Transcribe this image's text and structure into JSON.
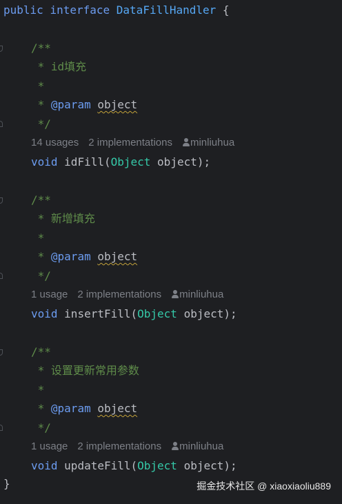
{
  "code": {
    "decl": {
      "kw1": "public",
      "kw2": "interface",
      "name": "DataFillHandler",
      "brace": "{"
    },
    "close_brace": "}",
    "methods": [
      {
        "comment_open": "/**",
        "desc": " * id填充",
        "blank": " *",
        "param_star": " * ",
        "param_tag": "@param",
        "param_name": "object",
        "comment_close": " */",
        "hint_usages": "14 usages",
        "hint_impl": "2 implementations",
        "hint_author": "minliuhua",
        "ret": "void",
        "name": "idFill",
        "ptype": "Object",
        "pname": "object",
        "end": ");"
      },
      {
        "comment_open": "/**",
        "desc": " * 新增填充",
        "blank": " *",
        "param_star": " * ",
        "param_tag": "@param",
        "param_name": "object",
        "comment_close": " */",
        "hint_usages": "1 usage",
        "hint_impl": "2 implementations",
        "hint_author": "minliuhua",
        "ret": "void",
        "name": "insertFill",
        "ptype": "Object",
        "pname": "object",
        "end": ");"
      },
      {
        "comment_open": "/**",
        "desc": " * 设置更新常用参数",
        "blank": " *",
        "param_star": " * ",
        "param_tag": "@param",
        "param_name": "object",
        "comment_close": " */",
        "hint_usages": "1 usage",
        "hint_impl": "2 implementations",
        "hint_author": "minliuhua",
        "ret": "void",
        "name": "updateFill",
        "ptype": "Object",
        "pname": "object",
        "end": ");"
      }
    ]
  },
  "watermark": "掘金技术社区 @ xiaoxiaoliu889",
  "colors": {
    "background": "#1e1f22",
    "keyword": "#6c9cf0",
    "type": "#35c9a8",
    "comment": "#5f8c4a",
    "hint": "#7d8087"
  }
}
